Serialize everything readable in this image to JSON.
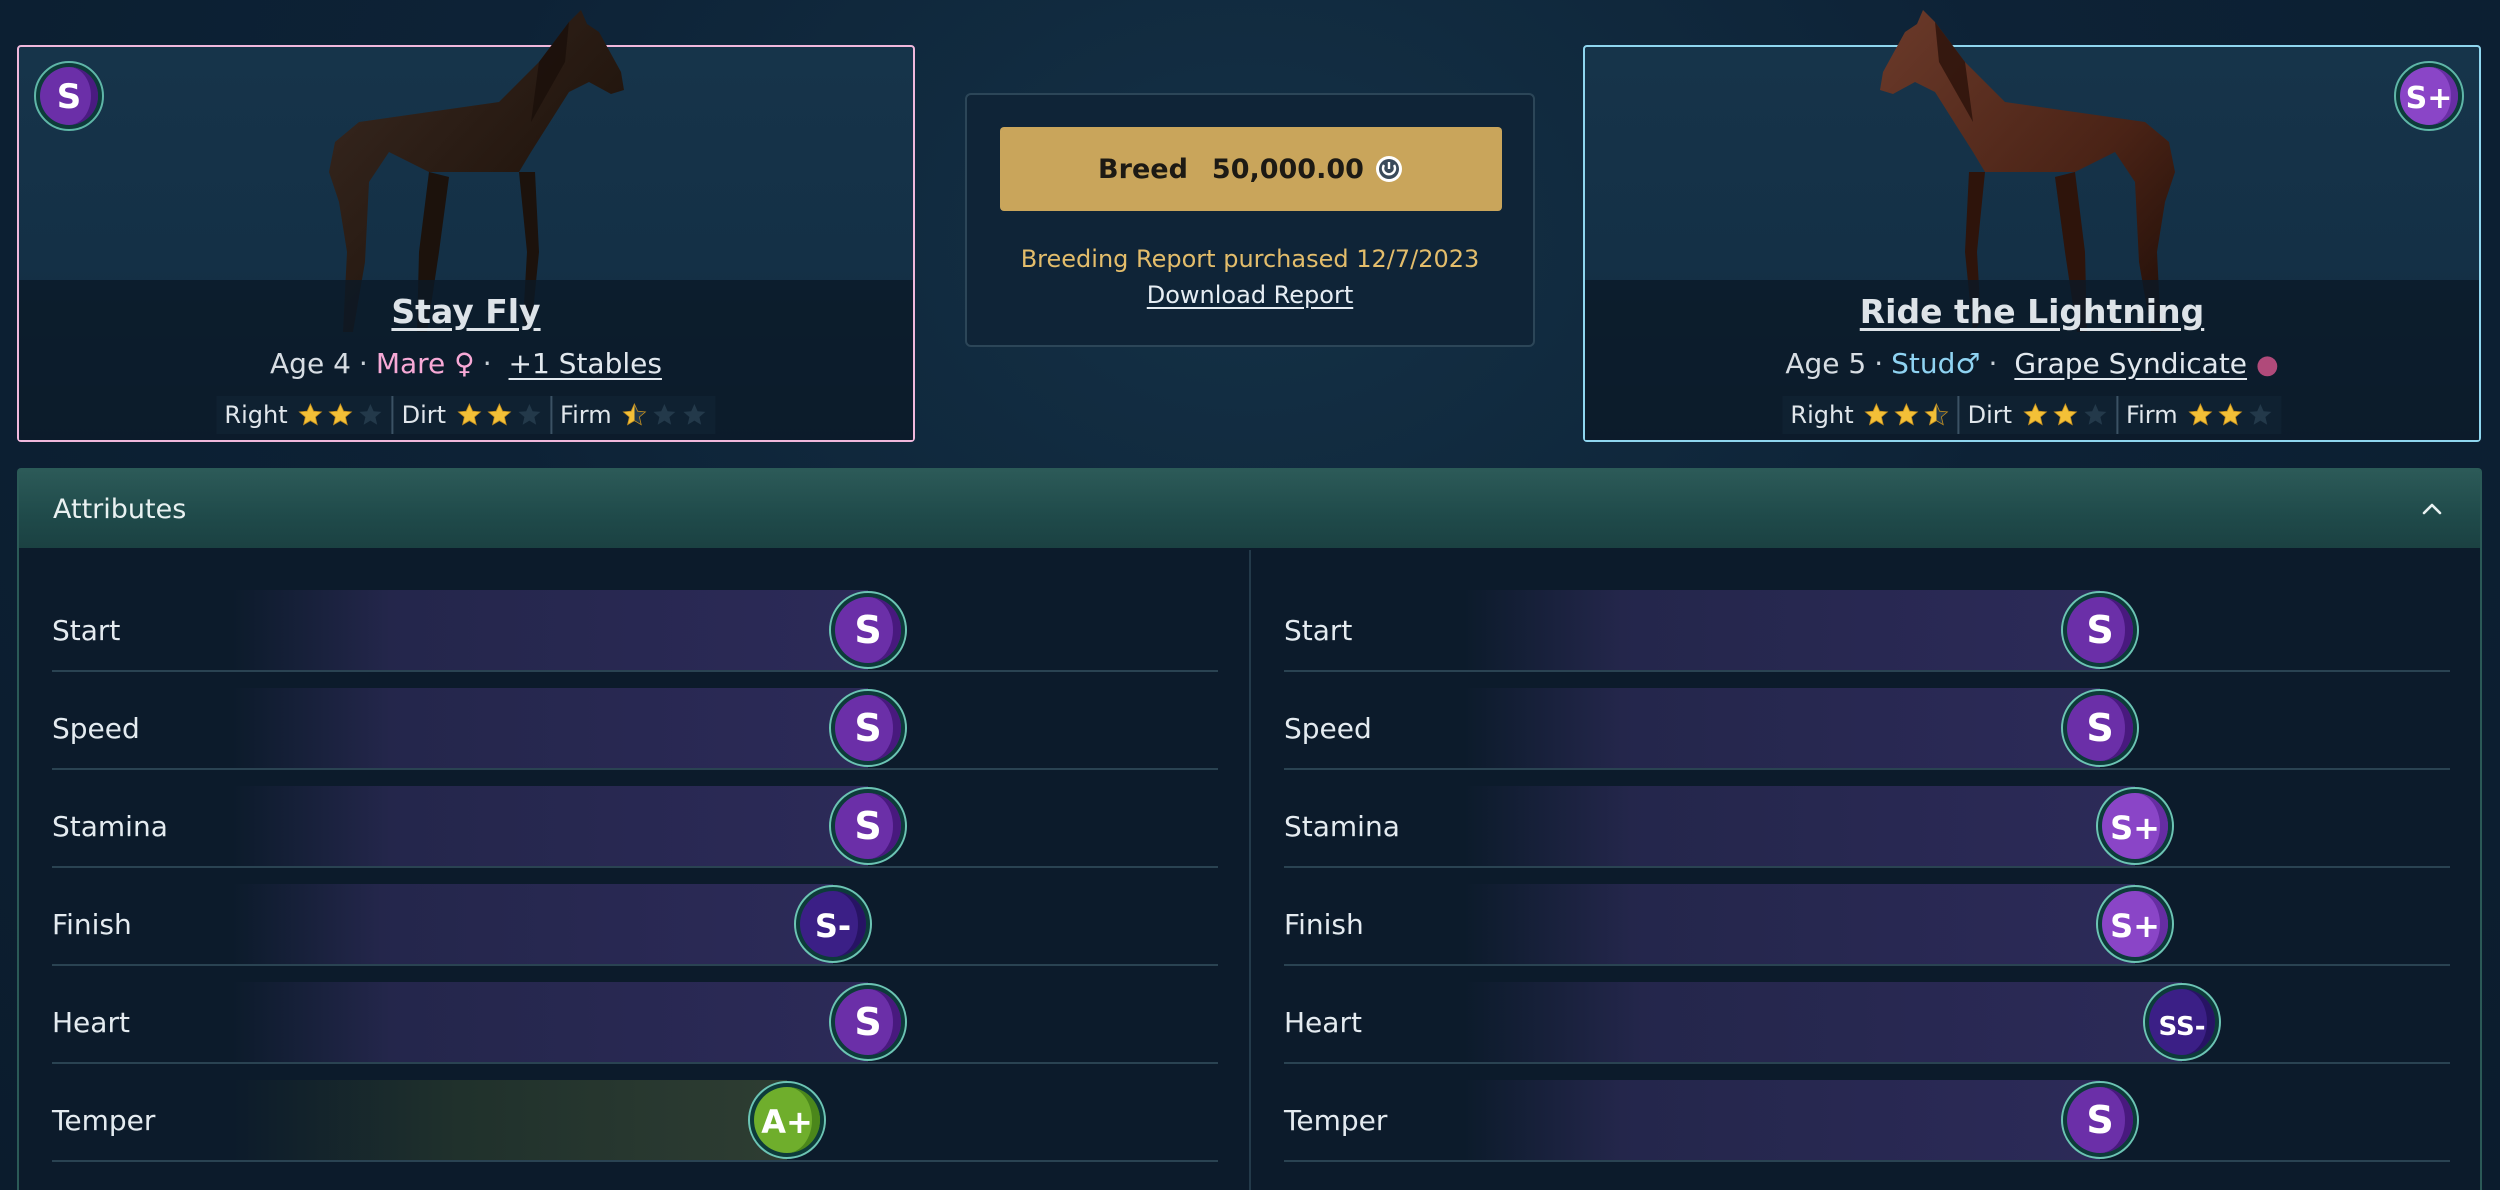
{
  "dam": {
    "name": "Stay Fly",
    "grade": "S",
    "age_text": "Age 4",
    "gender": "Mare",
    "gender_symbol": "♀",
    "owner_link": "+1 Stables",
    "ratings": [
      {
        "label": "Right",
        "stars": 2,
        "max": 3
      },
      {
        "label": "Dirt",
        "stars": 2,
        "max": 3
      },
      {
        "label": "Firm",
        "stars": 0.5,
        "max": 3
      }
    ]
  },
  "sire": {
    "name": "Ride the Lightning",
    "grade": "S+",
    "age_text": "Age 5",
    "gender": "Stud",
    "gender_symbol": "♂",
    "owner_link": "Grape Syndicate",
    "owner_icon": "grape-icon",
    "ratings": [
      {
        "label": "Right",
        "stars": 2.5,
        "max": 3
      },
      {
        "label": "Dirt",
        "stars": 2,
        "max": 3
      },
      {
        "label": "Firm",
        "stars": 2,
        "max": 3
      }
    ]
  },
  "breed": {
    "button_label": "Breed",
    "price": "50,000.00",
    "currency_icon": "coin-icon",
    "report_text": "Breeding Report purchased 12/7/2023",
    "download_label": "Download Report"
  },
  "attributes": {
    "title": "Attributes",
    "left": [
      {
        "label": "Start",
        "grade": "S",
        "level": 0.7
      },
      {
        "label": "Speed",
        "grade": "S",
        "level": 0.7
      },
      {
        "label": "Stamina",
        "grade": "S",
        "level": 0.7
      },
      {
        "label": "Finish",
        "grade": "S-",
        "level": 0.67
      },
      {
        "label": "Heart",
        "grade": "S",
        "level": 0.7
      },
      {
        "label": "Temper",
        "grade": "A+",
        "level": 0.63
      }
    ],
    "right": [
      {
        "label": "Start",
        "grade": "S",
        "level": 0.7
      },
      {
        "label": "Speed",
        "grade": "S",
        "level": 0.7
      },
      {
        "label": "Stamina",
        "grade": "S+",
        "level": 0.73
      },
      {
        "label": "Finish",
        "grade": "S+",
        "level": 0.73
      },
      {
        "label": "Heart",
        "grade": "SS-",
        "level": 0.77
      },
      {
        "label": "Temper",
        "grade": "S",
        "level": 0.7
      }
    ]
  },
  "colors": {
    "grade_purple": "#6b2fa8",
    "grade_green": "#6fae2c",
    "star_gold": "#f3c037",
    "breed_button": "#c9a55b",
    "mare_pink": "#f7a9d6",
    "stud_blue": "#8fd3f2"
  }
}
